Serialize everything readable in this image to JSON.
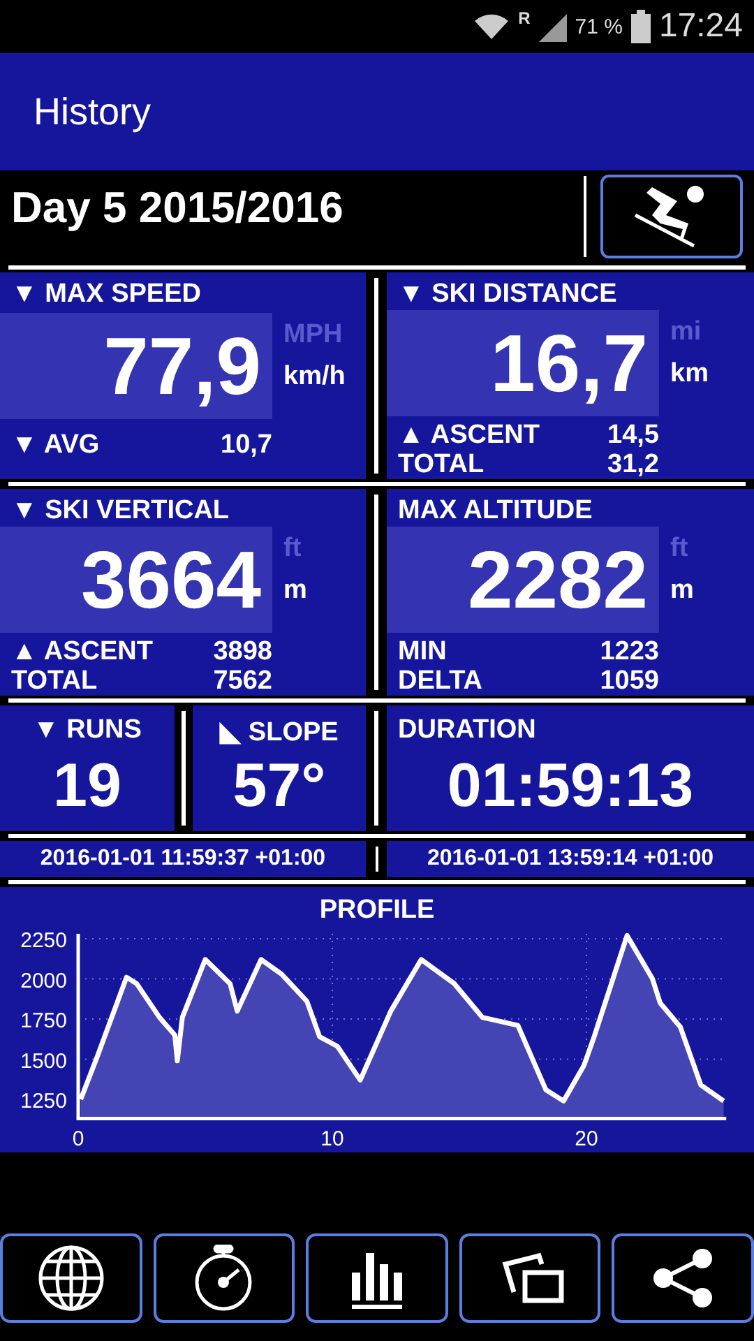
{
  "status_bar": {
    "network": "R",
    "battery": "71 %",
    "time": "17:24"
  },
  "app_bar": {
    "title": "History"
  },
  "day": {
    "title": "Day 5 2015/2016"
  },
  "cards": [
    {
      "title": "▼ MAX SPEED",
      "value": "77,9",
      "units": [
        {
          "label": "MPH",
          "selected": false
        },
        {
          "label": "km/h",
          "selected": true
        }
      ],
      "rows": [
        {
          "label": "▼ AVG",
          "value": "10,7"
        }
      ]
    },
    {
      "title": "▼ SKI DISTANCE",
      "value": "16,7",
      "units": [
        {
          "label": "mi",
          "selected": false
        },
        {
          "label": "km",
          "selected": true
        }
      ],
      "rows": [
        {
          "label": "▲ ASCENT",
          "value": "14,5"
        },
        {
          "label": "TOTAL",
          "value": "31,2"
        }
      ]
    },
    {
      "title": "▼ SKI VERTICAL",
      "value": "3664",
      "units": [
        {
          "label": "ft",
          "selected": false
        },
        {
          "label": "m",
          "selected": true
        }
      ],
      "rows": [
        {
          "label": "▲ ASCENT",
          "value": "3898"
        },
        {
          "label": "TOTAL",
          "value": "7562"
        }
      ]
    },
    {
      "title": "MAX ALTITUDE",
      "value": "2282",
      "units": [
        {
          "label": "ft",
          "selected": false
        },
        {
          "label": "m",
          "selected": true
        }
      ],
      "rows": [
        {
          "label": "MIN",
          "value": "1223"
        },
        {
          "label": "DELTA",
          "value": "1059"
        }
      ]
    }
  ],
  "summary": [
    {
      "title": "▼ RUNS",
      "value": "19"
    },
    {
      "title": "◣ SLOPE",
      "value": "57°"
    },
    {
      "title": "DURATION",
      "value": "01:59:13"
    }
  ],
  "times": [
    "2016-01-01 11:59:37 +01:00",
    "2016-01-01 13:59:14 +01:00"
  ],
  "profile": {
    "chart_data": {
      "type": "area",
      "title": "PROFILE",
      "x": [
        0.1,
        0.76,
        1.9,
        2.3,
        3.2,
        3.8,
        3.9,
        4.1,
        5.0,
        5.98,
        6.26,
        7.2,
        8.0,
        9.0,
        9.5,
        10.2,
        11.1,
        12.3,
        13.5,
        14.8,
        15.9,
        17.3,
        18.4,
        19.1,
        19.9,
        20.3,
        21.6,
        22.6,
        22.9,
        23.7,
        24.5,
        25.4
      ],
      "series": [
        {
          "color": "#ffffff",
          "values": [
            1250,
            1520,
            2010,
            1970,
            1760,
            1650,
            1490,
            1760,
            2120,
            1970,
            1800,
            2120,
            2030,
            1860,
            1640,
            1580,
            1370,
            1800,
            2120,
            1970,
            1760,
            1710,
            1310,
            1240,
            1460,
            1640,
            2270,
            2000,
            1850,
            1700,
            1340,
            1240
          ]
        }
      ],
      "grid": true,
      "xlim": [
        0,
        25.5
      ],
      "ylim": [
        1130,
        2280
      ],
      "xticks": [
        0,
        10,
        20
      ],
      "yticks": [
        1250,
        1500,
        1750,
        2000,
        2250
      ]
    }
  },
  "nav": [
    {
      "kind": "globe"
    },
    {
      "kind": "stopwatch"
    },
    {
      "kind": "bars"
    },
    {
      "kind": "screens"
    },
    {
      "kind": "share"
    }
  ]
}
